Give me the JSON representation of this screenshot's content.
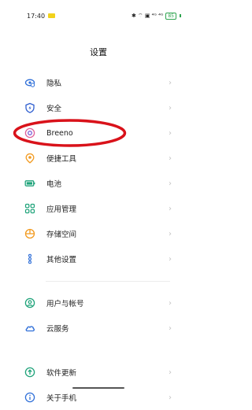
{
  "status": {
    "time": "17:40",
    "icons": "✱ ⌔ ▣ ⁴ᴳ ⁴ᴳ",
    "battery": "85"
  },
  "header": {
    "title": "设置"
  },
  "items": [
    {
      "label": "隐私",
      "icon": "privacy-icon"
    },
    {
      "label": "安全",
      "icon": "security-shield-icon"
    },
    {
      "label": "Breeno",
      "icon": "breeno-icon"
    },
    {
      "label": "便捷工具",
      "icon": "convenience-tools-icon"
    },
    {
      "label": "电池",
      "icon": "battery-icon"
    },
    {
      "label": "应用管理",
      "icon": "app-management-icon"
    },
    {
      "label": "存储空间",
      "icon": "storage-icon"
    },
    {
      "label": "其他设置",
      "icon": "other-settings-icon"
    },
    {
      "label": "用户与帐号",
      "icon": "user-accounts-icon"
    },
    {
      "label": "云服务",
      "icon": "cloud-icon"
    },
    {
      "label": "软件更新",
      "icon": "software-update-icon"
    },
    {
      "label": "关于手机",
      "icon": "about-phone-icon"
    }
  ],
  "chevron": "›",
  "colors": {
    "accent_green": "#2ea44f",
    "annotation_red": "#d9121a",
    "chevron": "#c3c3c3"
  }
}
